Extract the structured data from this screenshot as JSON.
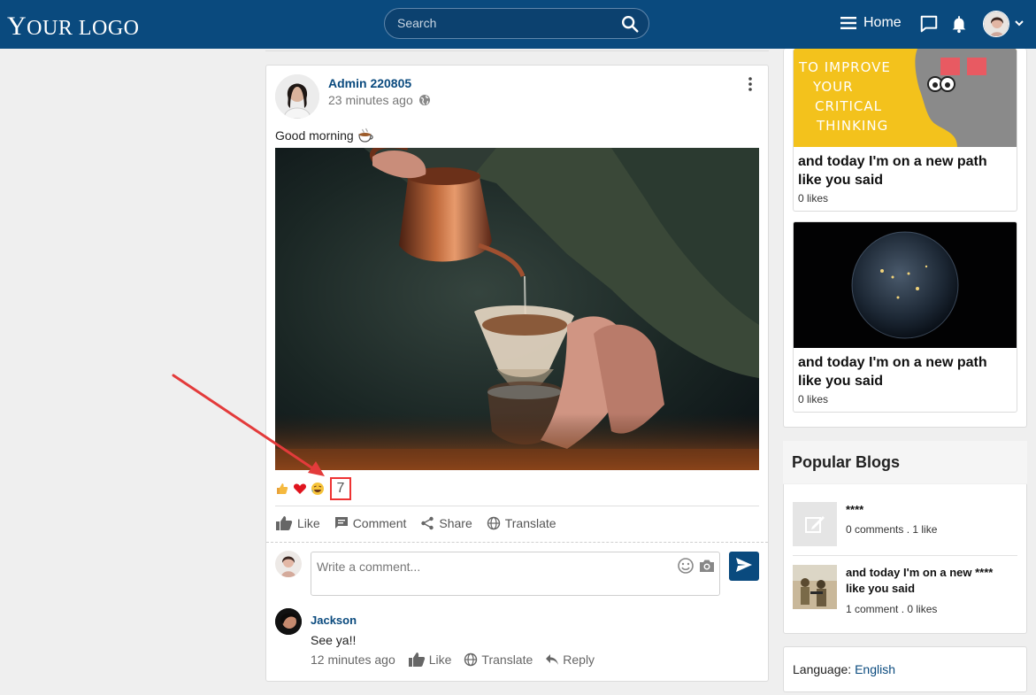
{
  "header": {
    "logo_first": "Y",
    "logo_rest": "OUR LOGO",
    "search_placeholder": "Search",
    "home_label": "Home"
  },
  "post": {
    "author": "Admin 220805",
    "time": "23 minutes ago",
    "text": "Good morning",
    "reaction_count": "7",
    "actions": {
      "like": "Like",
      "comment": "Comment",
      "share": "Share",
      "translate": "Translate"
    },
    "comment_placeholder": "Write a comment..."
  },
  "comment": {
    "author": "Jackson",
    "text": "See ya!!",
    "time": "12 minutes ago",
    "like": "Like",
    "translate": "Translate",
    "reply": "Reply"
  },
  "sidebar": {
    "tiles": [
      {
        "title": "and today I'm on a new path like you said",
        "likes": "0 likes",
        "image_text": "TO IMPROVE YOUR CRITICAL THINKING"
      },
      {
        "title": "and today I'm on a new path like you said",
        "likes": "0 likes"
      }
    ],
    "popular_title": "Popular Blogs",
    "popular": [
      {
        "name": "****",
        "meta": "0 comments . 1 like"
      },
      {
        "name": "and today I'm on a new **** like you said",
        "meta": "1 comment . 0 likes"
      }
    ],
    "language_label": "Language:",
    "language_value": "English"
  },
  "colors": {
    "brand": "#0a4a7e",
    "annotation": "#e33b3b"
  }
}
